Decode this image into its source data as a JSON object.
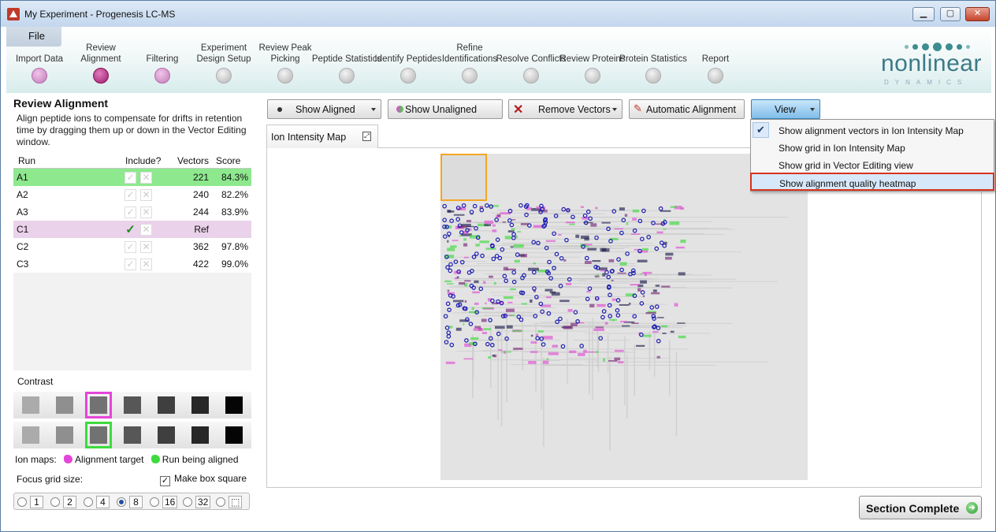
{
  "window": {
    "title": "My Experiment - Progenesis LC-MS"
  },
  "menu": {
    "file": "File"
  },
  "workflow": [
    {
      "label": "Import Data",
      "state": "done"
    },
    {
      "label": "Review Alignment",
      "state": "current"
    },
    {
      "label": "Filtering",
      "state": "done"
    },
    {
      "label": "Experiment Design Setup",
      "state": "todo"
    },
    {
      "label": "Review Peak Picking",
      "state": "todo"
    },
    {
      "label": "Peptide Statistics",
      "state": "todo"
    },
    {
      "label": "Identify Peptides",
      "state": "todo"
    },
    {
      "label": "Refine Identifications",
      "state": "todo"
    },
    {
      "label": "Resolve Conflicts",
      "state": "todo"
    },
    {
      "label": "Review Proteins",
      "state": "todo"
    },
    {
      "label": "Protein Statistics",
      "state": "todo"
    },
    {
      "label": "Report",
      "state": "todo"
    }
  ],
  "logo": {
    "text": "nonlinear",
    "sub": "DYNAMICS"
  },
  "panel": {
    "title": "Review Alignment",
    "description": "Align peptide ions to compensate for drifts in retention time by dragging them up or down in the Vector Editing window."
  },
  "runs": {
    "headers": {
      "run": "Run",
      "include": "Include?",
      "vectors": "Vectors",
      "score": "Score"
    },
    "rows": [
      {
        "run": "A1",
        "vectors": "221",
        "score": "84.3%",
        "style": "sel"
      },
      {
        "run": "A2",
        "vectors": "240",
        "score": "82.2%",
        "style": "plain"
      },
      {
        "run": "A3",
        "vectors": "244",
        "score": "83.9%",
        "style": "plain"
      },
      {
        "run": "C1",
        "vectors": "Ref",
        "score": "",
        "style": "ref"
      },
      {
        "run": "C2",
        "vectors": "362",
        "score": "97.8%",
        "style": "plain"
      },
      {
        "run": "C3",
        "vectors": "422",
        "score": "99.0%",
        "style": "plain"
      }
    ]
  },
  "contrast": {
    "label": "Contrast",
    "colors": [
      "#ababab",
      "#8f8f8f",
      "#727272",
      "#575757",
      "#3f3f3f",
      "#272727",
      "#050505"
    ],
    "selected_target": 3,
    "selected_aligned": 3
  },
  "ion_maps": {
    "label": "Ion maps:",
    "target": "Alignment target",
    "aligned": "Run being aligned",
    "target_color": "#e545d8",
    "aligned_color": "#3ddb3d"
  },
  "focus": {
    "label": "Focus grid size:",
    "square_label": "Make box square",
    "square_checked": true,
    "sizes": [
      "1",
      "2",
      "4",
      "8",
      "16",
      "32"
    ],
    "selected": "8"
  },
  "toolbar": {
    "show_aligned": "Show Aligned",
    "show_unaligned": "Show Unaligned",
    "remove_vectors": "Remove Vectors",
    "automatic_alignment": "Automatic Alignment",
    "view": "View"
  },
  "tab": {
    "label": "Ion Intensity Map"
  },
  "view_menu": [
    {
      "label": "Show alignment vectors in Ion Intensity Map",
      "checked": true
    },
    {
      "label": "Show grid in Ion Intensity Map",
      "checked": false
    },
    {
      "label": "Show grid in Vector Editing view",
      "checked": false
    },
    {
      "label": "Show alignment quality heatmap",
      "checked": false
    }
  ],
  "section_complete": "Section Complete",
  "colors": {
    "accent": "#7fbde9",
    "highlight": "#d9331f",
    "selected_row": "#8ee88e",
    "ref_row": "#ead2ea"
  }
}
